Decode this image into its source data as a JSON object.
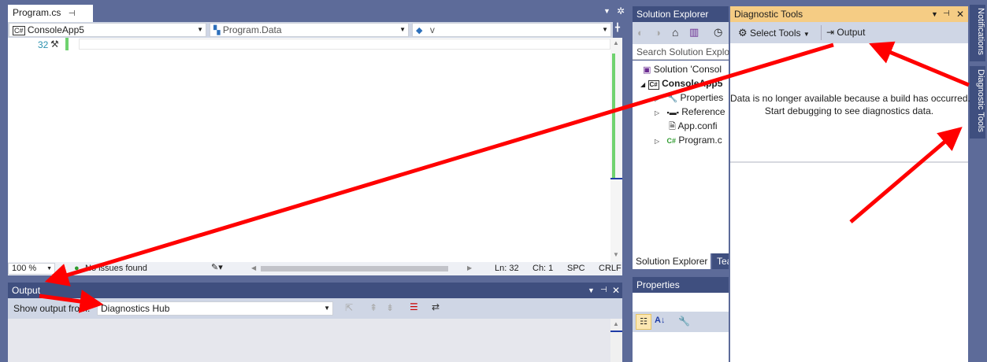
{
  "editor": {
    "tab_title": "Program.cs",
    "nav_project": "ConsoleApp5",
    "nav_type": "Program.Data",
    "nav_member": "v",
    "line_number": "32",
    "zoom": "100 %",
    "issues": "No issues found",
    "ln": "Ln: 32",
    "ch": "Ch: 1",
    "spc": "SPC",
    "crlf": "CRLF"
  },
  "output": {
    "title": "Output",
    "show_from_label": "Show output from:",
    "source": "Diagnostics Hub"
  },
  "solution_explorer": {
    "title": "Solution Explorer",
    "search_placeholder": "Search Solution Explor",
    "items": [
      "Solution 'Consol",
      "ConsoleApp5",
      "Properties",
      "Reference",
      "App.confi",
      "Program.c"
    ],
    "tab_active": "Solution Explorer",
    "tab_other": "Tea"
  },
  "properties": {
    "title": "Properties"
  },
  "diagnostic_tools": {
    "title": "Diagnostic Tools",
    "select_tools": "Select Tools",
    "output_button": "Output",
    "message_line1": "Data is no longer available because a build has occurred.",
    "message_line2": "Start debugging to see diagnostics data."
  },
  "side_tabs": [
    "Notifications",
    "Diagnostic Tools"
  ],
  "colors": {
    "frame": "#5d6b99",
    "panel_title": "#3f4f7f",
    "active_title": "#f5cc84",
    "toolbar": "#cfd6e5",
    "annotation_arrow": "#ff0000",
    "change_bar": "#6fd26f"
  }
}
